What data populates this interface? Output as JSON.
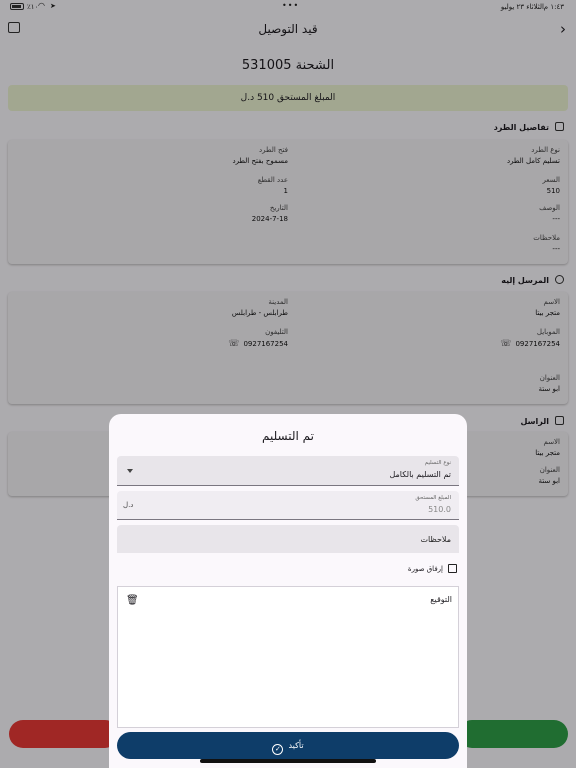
{
  "status_bar": {
    "time": "١:٤٣ م",
    "date": "الثلاثاء ٢٣ يوليو",
    "battery_pct": "٪١٠",
    "dots": "•••"
  },
  "app_bar": {
    "title": "قيد التوصيل"
  },
  "shipment": {
    "title": "الشحنة 531005"
  },
  "due_banner": {
    "text": "المبلغ المستحق  510 د.ل"
  },
  "package_section": {
    "header": "تفاصيل الطرد",
    "fields": [
      {
        "label": "نوع الطرد",
        "value": "تسليم كامل الطرد"
      },
      {
        "label": "فتح الطرد",
        "value": "مسموح بفتح الطرد"
      },
      {
        "label": "السعر",
        "value": "510"
      },
      {
        "label": "عدد القطع",
        "value": "1"
      },
      {
        "label": "الوصف",
        "value": "---"
      },
      {
        "label": "التاريخ",
        "value": "2024-7-18"
      },
      {
        "label": "ملاحظات",
        "value": "---"
      }
    ]
  },
  "recipient_section": {
    "header": "المرسل إليه",
    "fields": [
      {
        "label": "الاسم",
        "value": "متجر بيتا"
      },
      {
        "label": "المدينة",
        "value": "طرابلس - طرابلس"
      },
      {
        "label": "الموبايل",
        "value": "0927167254"
      },
      {
        "label": "التليفون",
        "value": "0927167254"
      },
      {
        "label": "العنوان",
        "value": "ابو ستة"
      }
    ]
  },
  "sender_section": {
    "header": "الراسل",
    "fields": [
      {
        "label": "الاسم",
        "value": "متجر بيتا"
      },
      {
        "label": "العنوان",
        "value": "ابو ستة"
      }
    ]
  },
  "sheet": {
    "title": "تم التسليم",
    "delivery_type": {
      "label": "نوع التسليم",
      "value": "تم التسليم بالكامل"
    },
    "amount_due": {
      "label": "المبلغ المستحق",
      "value": "510.0",
      "suffix": "د.ل"
    },
    "notes": {
      "placeholder": "ملاحظات"
    },
    "attach_label": "إرفاق صورة",
    "signature_label": "التوقيع",
    "confirm_label": "تأكيد"
  }
}
